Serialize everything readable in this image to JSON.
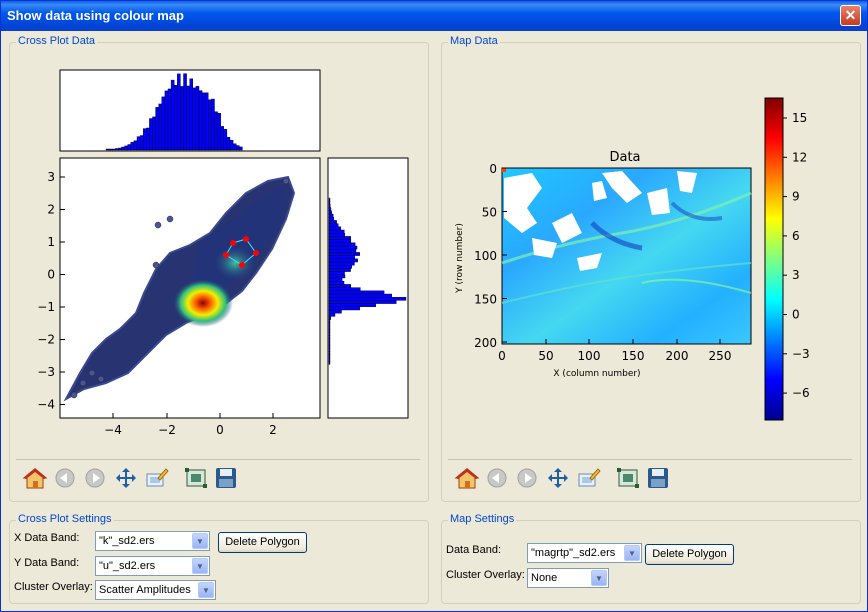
{
  "window": {
    "title": "Show data using colour map",
    "close_glyph": "✕"
  },
  "cross_plot": {
    "title": "Cross Plot Data",
    "xticks": [
      "−4",
      "−2",
      "0",
      "2"
    ],
    "yticks": [
      "3",
      "2",
      "1",
      "0",
      "−1",
      "−2",
      "−3",
      "−4"
    ]
  },
  "map": {
    "title": "Map Data",
    "plot_title": "Data",
    "xlabel": "X (column number)",
    "ylabel": "Y (row number)",
    "xticks": [
      "0",
      "50",
      "100",
      "150",
      "200",
      "250"
    ],
    "yticks": [
      "0",
      "50",
      "100",
      "150",
      "200"
    ],
    "colorbar_ticks": [
      "15",
      "12",
      "9",
      "6",
      "3",
      "0",
      "−3",
      "−6"
    ]
  },
  "toolbar_icons": [
    "home-icon",
    "back-icon",
    "forward-icon",
    "pan-icon",
    "zoom-icon",
    "subplots-icon",
    "save-icon"
  ],
  "cross_plot_settings": {
    "title": "Cross Plot Settings",
    "x_band_label": "X Data Band:",
    "x_band_value": "\"k\"_sd2.ers",
    "y_band_label": "Y Data Band:",
    "y_band_value": "\"u\"_sd2.ers",
    "cluster_label": "Cluster Overlay:",
    "cluster_value": "Scatter Amplitudes",
    "delete_polygon": "Delete Polygon"
  },
  "map_settings": {
    "title": "Map Settings",
    "band_label": "Data Band:",
    "band_value": "\"magrtp\"_sd2.ers",
    "cluster_label": "Cluster Overlay:",
    "cluster_value": "None",
    "delete_polygon": "Delete Polygon"
  },
  "colors": {
    "title_bar": "#0054e3",
    "group_title": "#0046d5",
    "histogram": "#0000ff"
  }
}
